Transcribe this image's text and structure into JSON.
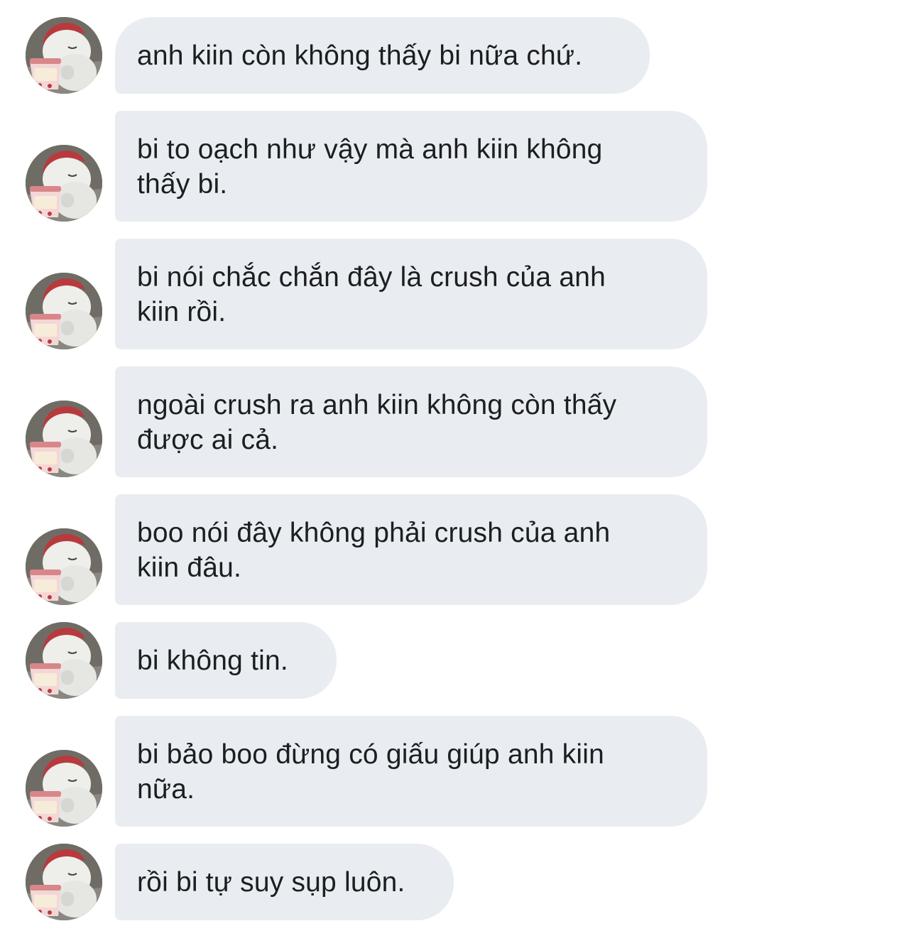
{
  "conversation": {
    "sender_avatar": "polar-bear-with-strawberry-ice-cream",
    "messages": [
      {
        "text": "anh kiin còn không thấy bi nữa chứ."
      },
      {
        "text": "bi to oạch như vậy mà anh kiin không\nthấy bi."
      },
      {
        "text": "bi nói chắc chắn đây là crush của anh\nkiin rồi."
      },
      {
        "text": "ngoài crush ra anh kiin không còn thấy\nđược ai cả."
      },
      {
        "text": "boo nói đây không phải crush của anh\nkiin đâu."
      },
      {
        "text": "bi không tin."
      },
      {
        "text": "bi bảo boo đừng có giấu giúp anh kiin\nnữa."
      },
      {
        "text": "rồi bi tự suy sụp luôn."
      }
    ]
  },
  "colors": {
    "bubble_background": "#e9edf1",
    "message_text": "#1c1e21",
    "page_background": "#ffffff"
  }
}
